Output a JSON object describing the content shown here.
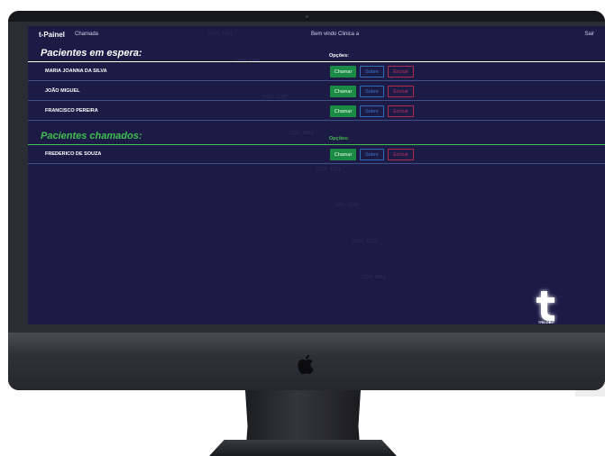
{
  "app": {
    "brand": "t-Painel",
    "nav_link": "Chamada",
    "welcome": "Bem vindo Clinica a",
    "logout": "Sair"
  },
  "waiting": {
    "title": "Pacientes em espera:",
    "options_label": "Opções:",
    "patients": [
      {
        "name": "MARIA JOANNA DA SILVA"
      },
      {
        "name": "JOÃO MIGUEL"
      },
      {
        "name": "FRANCISCO PEREIRA"
      }
    ]
  },
  "called": {
    "title": "Pacientes chamados:",
    "options_label": "Opções:",
    "patients": [
      {
        "name": "FREDERICO DE SOUZA"
      }
    ]
  },
  "buttons": {
    "call": "Chamar",
    "about": "Sobre",
    "delete": "Excluir"
  },
  "logo_text": "TRILOBIT",
  "colors": {
    "screen_bg": "#1c1b46",
    "waiting_title": "#ffffff",
    "called_title": "#3fbf4f",
    "call_button": "#1a8a45",
    "about_button": "#2f6db8",
    "delete_button": "#b02a4c"
  }
}
